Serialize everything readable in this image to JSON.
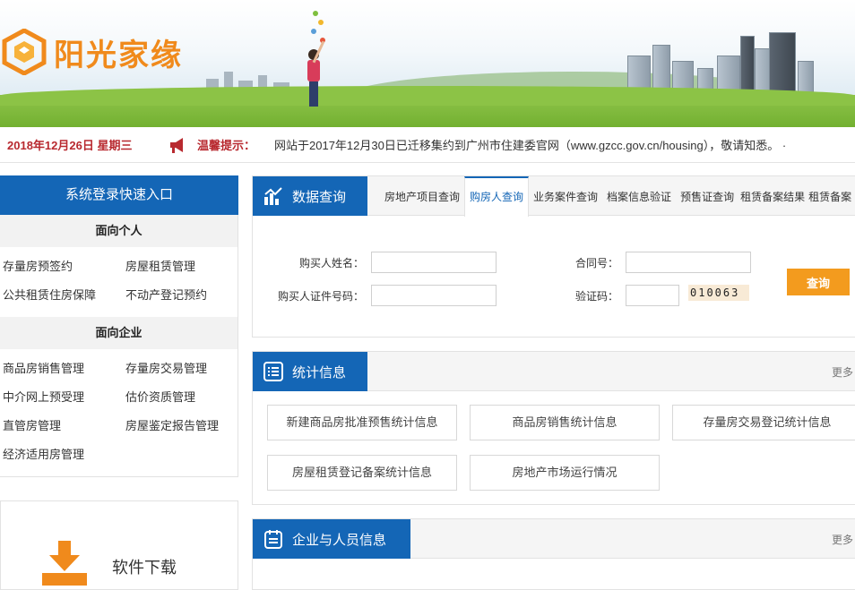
{
  "header": {
    "logo_text": "阳光家缘",
    "brand_color": "#f08a1c"
  },
  "notice": {
    "date": "2018年12月26日 星期三",
    "tip_label": "温馨提示：",
    "message": "网站于2017年12月30日已迁移集约到广州市住建委官网（www.gzcc.gov.cn/housing），敬请知悉。  ·"
  },
  "left": {
    "quick_title": "系统登录快速入口",
    "personal": {
      "title": "面向个人",
      "links": [
        "存量房预签约",
        "房屋租赁管理",
        "公共租赁住房保障",
        "不动产登记预约"
      ]
    },
    "enterprise": {
      "title": "面向企业",
      "links": [
        "商品房销售管理",
        "存量房交易管理",
        "中介网上预受理",
        "估价资质管理",
        "直管房管理",
        "房屋鉴定报告管理",
        "经济适用房管理"
      ]
    },
    "download_label": "软件下载"
  },
  "query": {
    "title": "数据查询",
    "tabs": [
      "房地产项目查询",
      "购房人查询",
      "业务案件查询",
      "档案信息验证",
      "预售证查询",
      "租赁备案结果",
      "租赁备案"
    ],
    "active_tab": "购房人查询",
    "fields": {
      "buyer_name": "购买人姓名：",
      "contract_no": "合同号：",
      "buyer_id": "购买人证件号码：",
      "captcha": "验证码："
    },
    "captcha_code": "010063",
    "submit": "查询"
  },
  "stats": {
    "title": "统计信息",
    "more": "更多",
    "buttons": [
      "新建商品房批准预售统计信息",
      "商品房销售统计信息",
      "存量房交易登记统计信息",
      "房屋租赁登记备案统计信息",
      "房地产市场运行情况"
    ]
  },
  "enterprise_info": {
    "title": "企业与人员信息",
    "more": "更多"
  },
  "colors": {
    "primary": "#1466b6",
    "accent": "#f39b1e",
    "alert": "#b8292f"
  }
}
